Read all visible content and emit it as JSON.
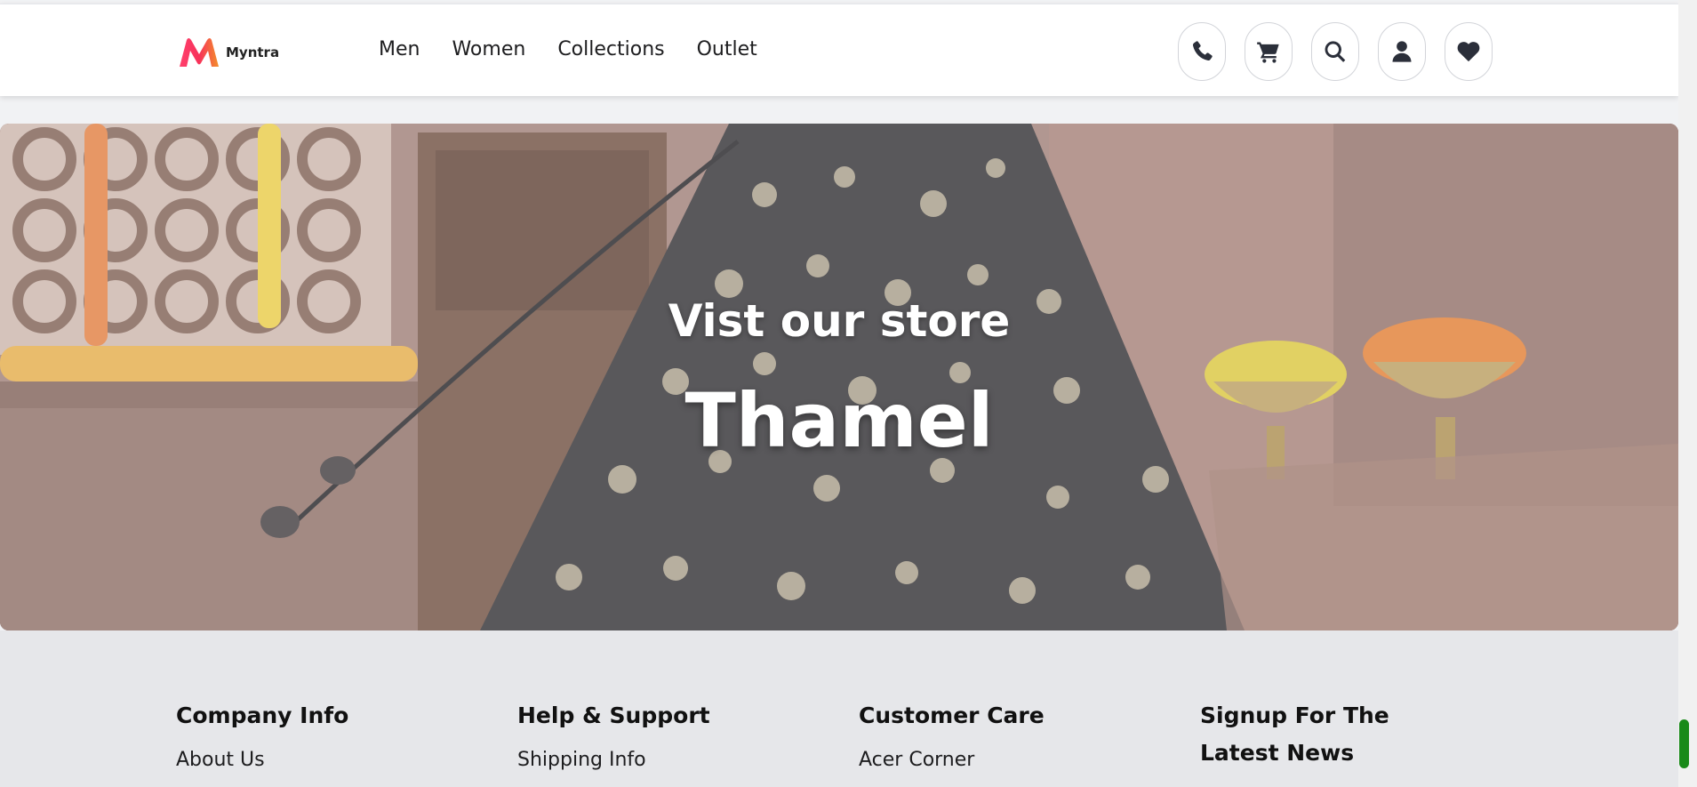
{
  "brand": {
    "name": "Myntra",
    "accent": "#ff3f6c"
  },
  "nav": {
    "items": [
      "Men",
      "Women",
      "Collections",
      "Outlet"
    ]
  },
  "header_icons": [
    "phone-icon",
    "cart-icon",
    "search-icon",
    "user-icon",
    "heart-icon"
  ],
  "hero": {
    "subtitle": "Vist our store",
    "title": "Thamel"
  },
  "footer": {
    "columns": [
      {
        "heading": "Company Info",
        "first_link": "About Us"
      },
      {
        "heading": "Help & Support",
        "first_link": "Shipping Info"
      },
      {
        "heading": "Customer Care",
        "first_link": "Acer Corner"
      },
      {
        "heading": "Signup For The Latest News",
        "first_link": ""
      }
    ]
  },
  "colors": {
    "header_bg": "#ffffff",
    "footer_bg": "#e6e7ea",
    "scroll_thumb": "#1a8a1a"
  }
}
